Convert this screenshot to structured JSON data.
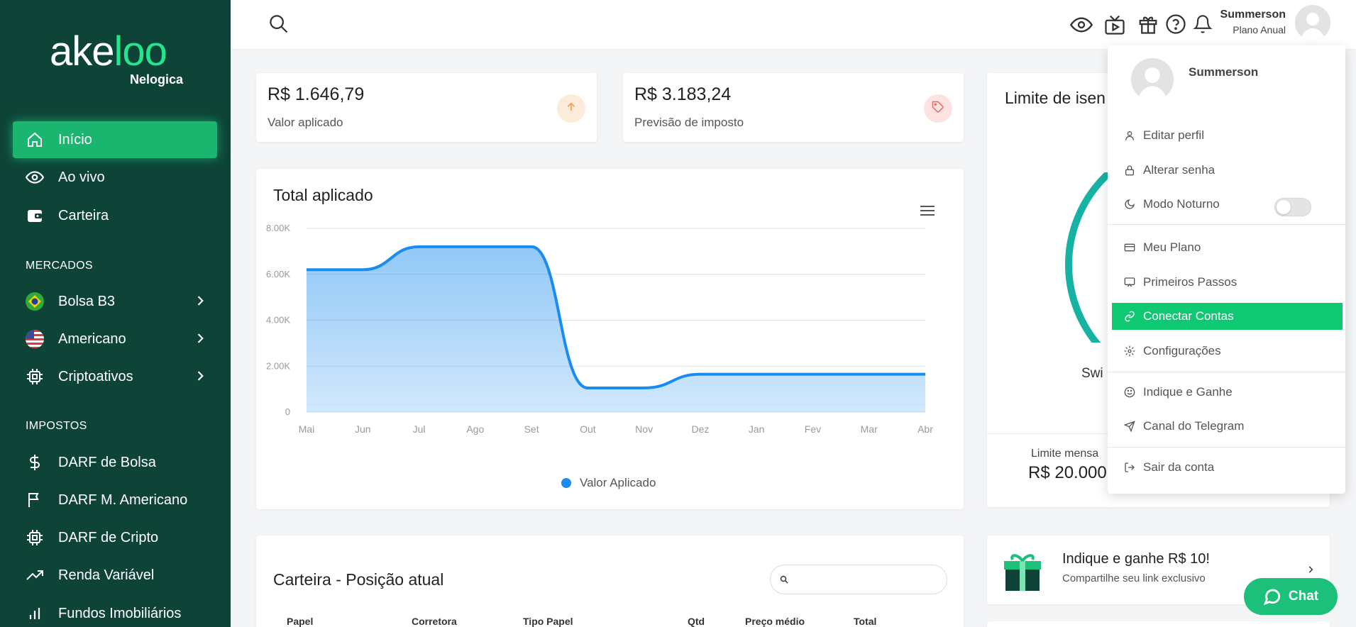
{
  "brand": {
    "name_part1": "ake",
    "name_part2": "loo",
    "sub": "Nelogica",
    "accent": "#22e58c",
    "sidebar_bg": "#0e4437"
  },
  "sidebar": {
    "items": [
      {
        "label": "Início",
        "icon": "home-icon"
      },
      {
        "label": "Ao vivo",
        "icon": "eye-icon"
      },
      {
        "label": "Carteira",
        "icon": "wallet-icon"
      }
    ],
    "mercados_label": "MERCADOS",
    "mercados": [
      {
        "label": "Bolsa B3",
        "icon": "brazil-flag-icon"
      },
      {
        "label": "Americano",
        "icon": "usa-flag-icon"
      },
      {
        "label": "Criptoativos",
        "icon": "chip-icon"
      }
    ],
    "impostos_label": "IMPOSTOS",
    "impostos": [
      {
        "label": "DARF de Bolsa",
        "icon": "dollar-icon"
      },
      {
        "label": "DARF M. Americano",
        "icon": "flag-icon"
      },
      {
        "label": "DARF de Cripto",
        "icon": "chip-icon"
      },
      {
        "label": "Renda Variável",
        "icon": "trending-up-icon"
      },
      {
        "label": "Fundos Imobiliários",
        "icon": "bar-chart-icon"
      }
    ]
  },
  "topbar": {
    "user_name": "Summerson",
    "user_plan": "Plano Anual"
  },
  "stats": [
    {
      "value": "R$ 1.646,79",
      "label": "Valor aplicado",
      "icon": "arrow-up-icon",
      "badge_color": "#fdebd9",
      "icon_color": "#f0a050"
    },
    {
      "value": "R$ 3.183,24",
      "label": "Previsão de imposto",
      "icon": "tag-icon",
      "badge_color": "#fde2e2",
      "icon_color": "#e86a6a"
    }
  ],
  "chart_card": {
    "title": "Total aplicado",
    "legend": "Valor Aplicado"
  },
  "chart_data": {
    "type": "area",
    "title": "Total aplicado",
    "categories": [
      "Mai",
      "Jun",
      "Jul",
      "Ago",
      "Set",
      "Out",
      "Nov",
      "Dez",
      "Jan",
      "Fev",
      "Mar",
      "Abr"
    ],
    "series": [
      {
        "name": "Valor Aplicado",
        "values": [
          6200,
          6200,
          7200,
          7200,
          7200,
          1050,
          1050,
          1650,
          1650,
          1650,
          1650,
          1650
        ]
      }
    ],
    "y_ticks": [
      "0",
      "2.00K",
      "4.00K",
      "6.00K",
      "8.00K"
    ],
    "ylim": [
      0,
      8000
    ],
    "grid": true,
    "legend_position": "bottom",
    "color": "#1a8cf0"
  },
  "side_card": {
    "title": "Limite de isen",
    "swing_label": "Swi",
    "limit_label": "Limite mensa",
    "limit_value": "R$ 20.000"
  },
  "promo": {
    "title": "Indique e ganhe R$ 10!",
    "subtitle": "Compartilhe seu link exclusivo"
  },
  "carteira": {
    "title": "Carteira - Posição atual",
    "search_placeholder": "",
    "columns": [
      "Papel",
      "Corretora",
      "Tipo Papel",
      "Qtd",
      "Preço médio",
      "Total"
    ]
  },
  "dropdown": {
    "name": "Summerson",
    "items": [
      {
        "label": "Editar perfil",
        "icon": "user-icon"
      },
      {
        "label": "Alterar senha",
        "icon": "lock-icon"
      },
      {
        "label": "Modo Noturno",
        "icon": "moon-icon"
      },
      {
        "label": "Meu Plano",
        "icon": "credit-card-icon"
      },
      {
        "label": "Primeiros Passos",
        "icon": "cast-icon"
      },
      {
        "label": "Conectar Contas",
        "icon": "link-icon"
      },
      {
        "label": "Configurações",
        "icon": "gear-icon"
      },
      {
        "label": "Indique e Ganhe",
        "icon": "smile-icon"
      },
      {
        "label": "Canal do Telegram",
        "icon": "send-icon"
      },
      {
        "label": "Sair da conta",
        "icon": "logout-icon"
      }
    ]
  },
  "chat": {
    "label": "Chat"
  }
}
